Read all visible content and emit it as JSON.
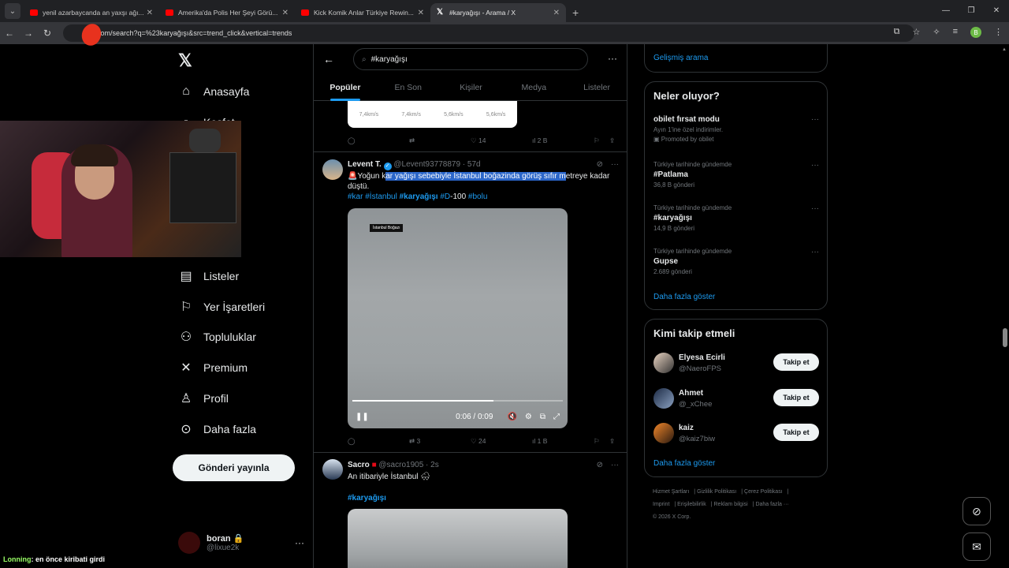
{
  "browser": {
    "tabs": [
      {
        "title": "yenil azarbaycanda an yaxşı ağı...",
        "favicon": "youtube-icon"
      },
      {
        "title": "Amerika'da Polis Her Şeyi Görü...",
        "favicon": "youtube-icon"
      },
      {
        "title": "Kick Komik Anlar Türkiye Rewin...",
        "favicon": "youtube-icon"
      },
      {
        "title": "#karyağışı - Arama / X",
        "favicon": "x-icon"
      }
    ],
    "url": "x.com/search?q=%23karyağışı&src=trend_click&vertical=trends",
    "profile_initial": "B"
  },
  "sidebar": {
    "items": [
      {
        "label": "Anasayfa",
        "icon": "home-icon"
      },
      {
        "label": "Keşfet",
        "icon": "search-icon"
      },
      {
        "label": "Listeler",
        "icon": "list-icon"
      },
      {
        "label": "Yer İşaretleri",
        "icon": "bookmark-icon"
      },
      {
        "label": "Topluluklar",
        "icon": "communities-icon"
      },
      {
        "label": "Premium",
        "icon": "x-icon"
      },
      {
        "label": "Profil",
        "icon": "profile-icon"
      },
      {
        "label": "Daha fazla",
        "icon": "more-icon"
      }
    ],
    "post_button": "Gönderi yayınla",
    "account": {
      "name": "boran",
      "handle": "@lixue2k"
    }
  },
  "search": {
    "query": "#karyağışı",
    "tabs": [
      "Popüler",
      "En Son",
      "Kişiler",
      "Medya",
      "Listeler"
    ],
    "active_tab": "Popüler"
  },
  "prev_card": {
    "values": [
      "7,4km/s",
      "7,4km/s",
      "5,6km/s",
      "5,6km/s"
    ]
  },
  "prev_actions": {
    "replies": "",
    "reposts": "",
    "likes": "14",
    "views": "2 B"
  },
  "tweet1": {
    "name": "Levent T.",
    "handle": "@Levent93778879",
    "time": "· 57d",
    "text_pre": "Yoğun k",
    "text_hl": "ar yağışı sebebiyle İstanbul boğazinda görüş sıfır m",
    "text_post": "etreye kadar düştü.",
    "tags": [
      "#kar",
      "#İstanbul",
      "#karyağışı",
      "#D",
      "-100",
      "#bolu"
    ],
    "video_label": "İstanbul Boğazı",
    "video_time": "0:06 / 0:09",
    "video_progress": 0.67,
    "replies": "",
    "reposts": "3",
    "likes": "24",
    "views": "1 B"
  },
  "tweet2": {
    "name": "Sacro",
    "handle": "@sacro1905",
    "time": "· 2s",
    "text": "An itibariyle İstanbul 🌨",
    "tag": "#karyağışı"
  },
  "right": {
    "advanced_search": "Gelişmiş arama",
    "trends_title": "Neler oluyor?",
    "trends": [
      {
        "context": "",
        "title": "obilet fırsat modu",
        "count": "Ayın 1'ine özel indirimler.",
        "extra": "Promoted by obilet"
      },
      {
        "context": "Türkiye tarihinde gündemde",
        "title": "#Patlama",
        "count": "36,8 B gönderi"
      },
      {
        "context": "Türkiye tarihinde gündemde",
        "title": "#karyağışı",
        "count": "14,9 B gönderi"
      },
      {
        "context": "Türkiye tarihinde gündemde",
        "title": "Gupse",
        "count": "2.689 gönderi"
      }
    ],
    "show_more": "Daha fazla göster",
    "follow_title": "Kimi takip etmeli",
    "follow": [
      {
        "name": "Elyesa Ecirli",
        "handle": "@NaeroFPS",
        "button": "Takip et"
      },
      {
        "name": "Ahmet",
        "handle": "@_xChee",
        "button": "Takip et"
      },
      {
        "name": "kaiz",
        "handle": "@kaiz7biw",
        "button": "Takip et"
      }
    ],
    "follow_more": "Daha fazla göster",
    "footer": [
      "Hizmet Şartları",
      "Gizlilik Politikası",
      "Çerez Politikası",
      "Imprint",
      "Erişilebilirlik",
      "Reklam bilgisi",
      "Daha fazla ···",
      "© 2026 X Corp."
    ]
  },
  "chat": {
    "user": "Lonning",
    "message": ": en önce kiribati girdi"
  }
}
